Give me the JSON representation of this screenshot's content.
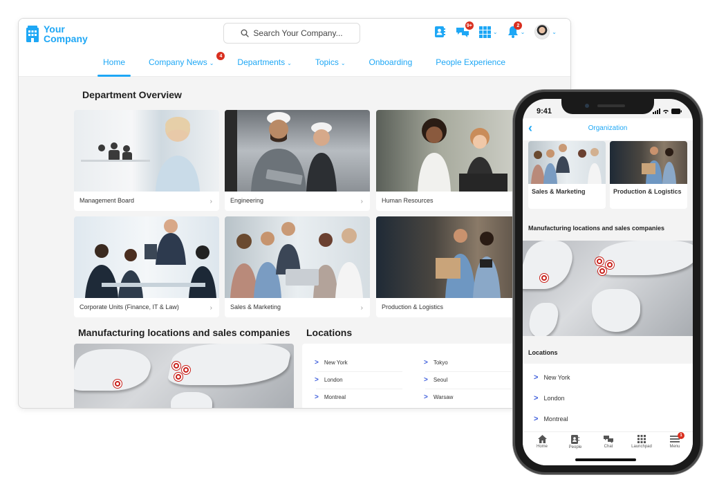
{
  "desktop": {
    "logo": {
      "line1": "Your",
      "line2": "Company"
    },
    "search": {
      "placeholder": "Search Your Company..."
    },
    "toolbar": {
      "chat_badge": "9+",
      "notifications_badge": "2"
    },
    "nav": [
      {
        "label": "Home",
        "active": true
      },
      {
        "label": "Company News",
        "badge": "4",
        "dropdown": true
      },
      {
        "label": "Departments",
        "dropdown": true
      },
      {
        "label": "Topics",
        "dropdown": true
      },
      {
        "label": "Onboarding"
      },
      {
        "label": "People Experience"
      }
    ],
    "department_overview": {
      "title": "Department Overview",
      "cards": [
        {
          "label": "Management Board"
        },
        {
          "label": "Engineering"
        },
        {
          "label": "Human Resources"
        },
        {
          "label": "Corporate Units (Finance, IT & Law)"
        },
        {
          "label": "Sales & Marketing"
        },
        {
          "label": "Production & Logistics"
        }
      ]
    },
    "map_section": {
      "title": "Manufacturing locations and sales companies"
    },
    "locations": {
      "title": "Locations",
      "col1": [
        "New York",
        "London",
        "Montreal"
      ],
      "col2": [
        "Tokyo",
        "Seoul",
        "Warsaw"
      ]
    }
  },
  "phone": {
    "status_time": "9:41",
    "header_title": "Organization",
    "cards": [
      {
        "label": "Sales & Marketing"
      },
      {
        "label": "Production & Logistics"
      }
    ],
    "map_title": "Manufacturing locations and sales companies",
    "locations_title": "Locations",
    "locations": [
      "New York",
      "London",
      "Montreal"
    ],
    "tabs": [
      {
        "label": "Home",
        "icon": "home-icon"
      },
      {
        "label": "People",
        "icon": "contacts-icon"
      },
      {
        "label": "Chat",
        "icon": "chat-icon"
      },
      {
        "label": "Launchpad",
        "icon": "grid-icon"
      },
      {
        "label": "Menu",
        "icon": "menu-icon",
        "badge": "1"
      }
    ]
  },
  "colors": {
    "accent": "#1ea7f5",
    "badge": "#d92f1f",
    "link_arrow": "#3b5bdb"
  }
}
